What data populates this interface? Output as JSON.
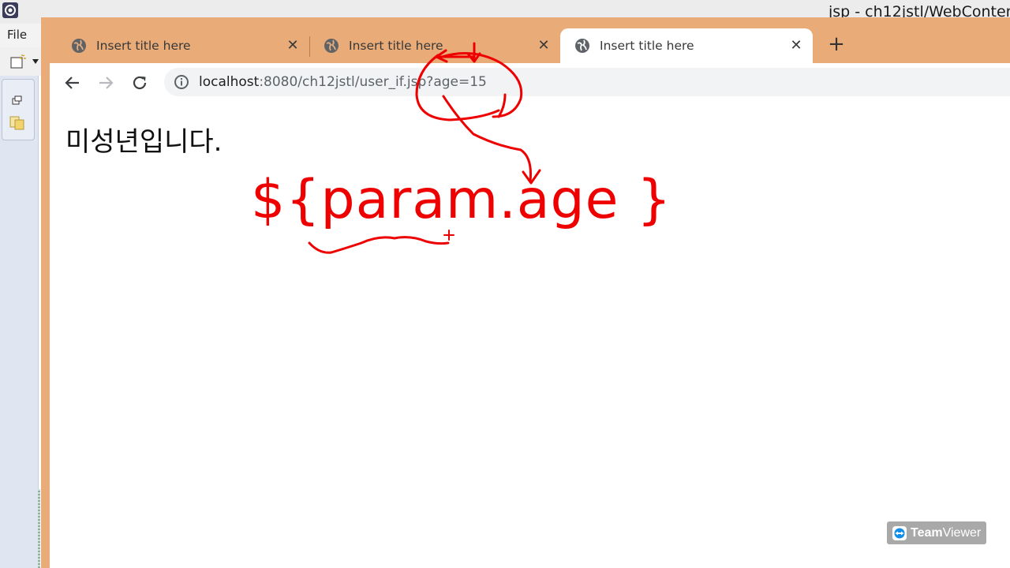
{
  "eclipse": {
    "window_title": "jsp - ch12jstl/WebConten",
    "menu_file": "File"
  },
  "browser": {
    "tabs": [
      {
        "label": "Insert title here",
        "active": false
      },
      {
        "label": "Insert title here",
        "active": false
      },
      {
        "label": "Insert title here",
        "active": true
      }
    ],
    "new_tab_label": "+",
    "url_host": "localhost",
    "url_rest": ":8080/ch12jstl/user_if.jsp?age=15"
  },
  "page": {
    "text": "미성년입니다."
  },
  "annotation": {
    "text": "${param.age }",
    "color": "#ee0000"
  },
  "teamviewer": {
    "bold": "Team",
    "rest": "Viewer"
  },
  "colors": {
    "chrome_frame": "#e9ab78",
    "omnibox": "#f1f3f4"
  }
}
